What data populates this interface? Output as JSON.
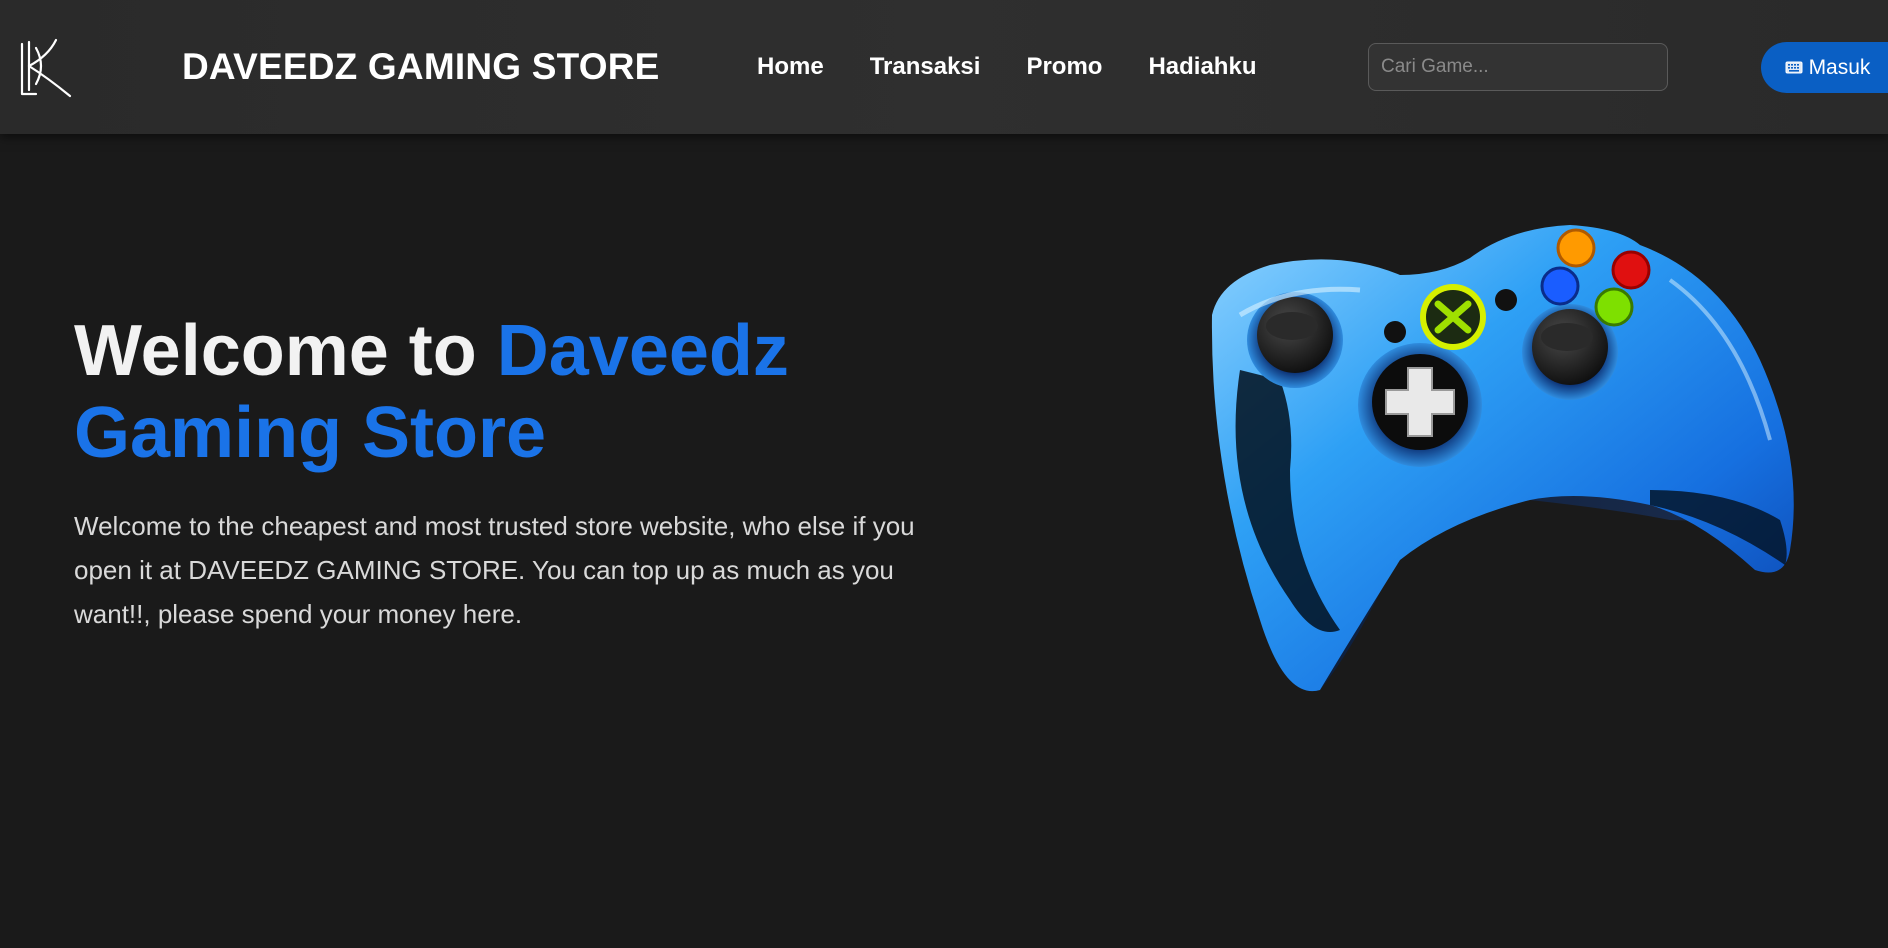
{
  "header": {
    "logo_icon": "dk-monogram-logo",
    "brand": "DAVEEDZ GAMING STORE",
    "nav": [
      {
        "label": "Home"
      },
      {
        "label": "Transaksi"
      },
      {
        "label": "Promo"
      },
      {
        "label": "Hadiahku"
      }
    ],
    "search": {
      "placeholder": "Cari Game...",
      "value": ""
    },
    "login": {
      "label": "Masuk",
      "icon": "keyboard-icon"
    }
  },
  "hero": {
    "title_prefix": "Welcome to ",
    "title_accent": "Daveedz Gaming Store",
    "description": "Welcome to the cheapest and most trusted store website, who else if you open it at DAVEEDZ GAMING STORE. You can top up as much as you want!!, please spend your money here.",
    "image": "blue-game-controller"
  },
  "colors": {
    "background": "#1a1a1a",
    "navbar": "#2c2c2c",
    "accent": "#1a73e8",
    "button": "#0a5fc4",
    "text": "#ffffff"
  }
}
